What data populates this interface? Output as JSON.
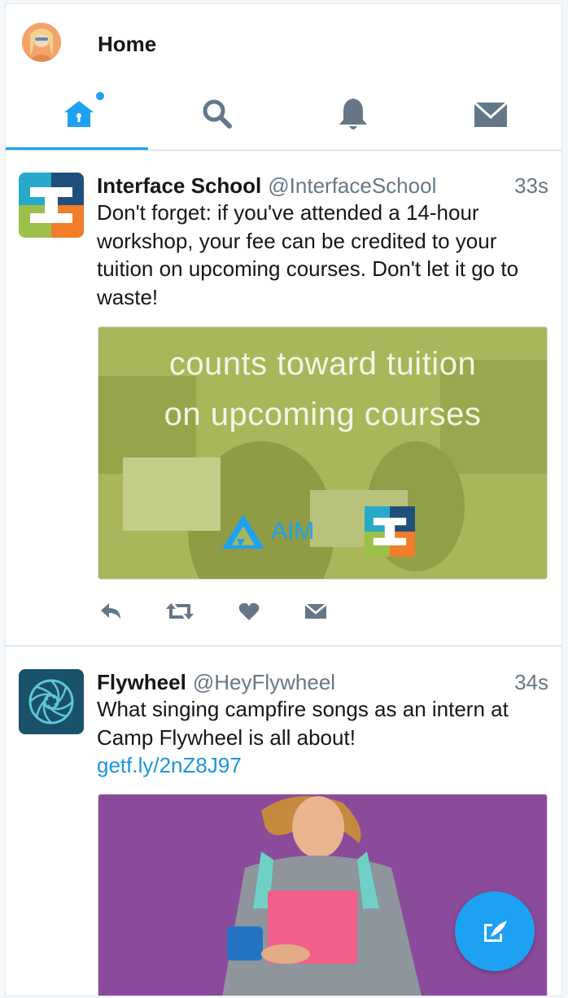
{
  "header": {
    "title": "Home"
  },
  "tabs": [
    {
      "name": "home",
      "icon": "home-icon",
      "active": true
    },
    {
      "name": "search",
      "icon": "search-icon"
    },
    {
      "name": "notifications",
      "icon": "bell-icon"
    },
    {
      "name": "messages",
      "icon": "envelope-icon"
    }
  ],
  "tweets": [
    {
      "name": "Interface School",
      "handle": "@InterfaceSchool",
      "time": "33s",
      "text": "Don't forget: if you've attended a 14-hour workshop, your fee can be credited to your tuition on upcoming courses. Don't let it go to waste!",
      "media": {
        "line1": "counts toward tuition",
        "line2": "on upcoming courses",
        "logo_text": "AIM"
      }
    },
    {
      "name": "Flywheel",
      "handle": "@HeyFlywheel",
      "time": "34s",
      "text": "What singing campfire songs as an intern at Camp Flywheel is all about!",
      "link": "getf.ly/2nZ8J97"
    }
  ],
  "colors": {
    "accent": "#1da1f2",
    "icon_gray": "#657786",
    "media_green": "#a7b456",
    "media_purple": "#8a4a99"
  },
  "fab": {
    "icon": "compose-icon"
  }
}
